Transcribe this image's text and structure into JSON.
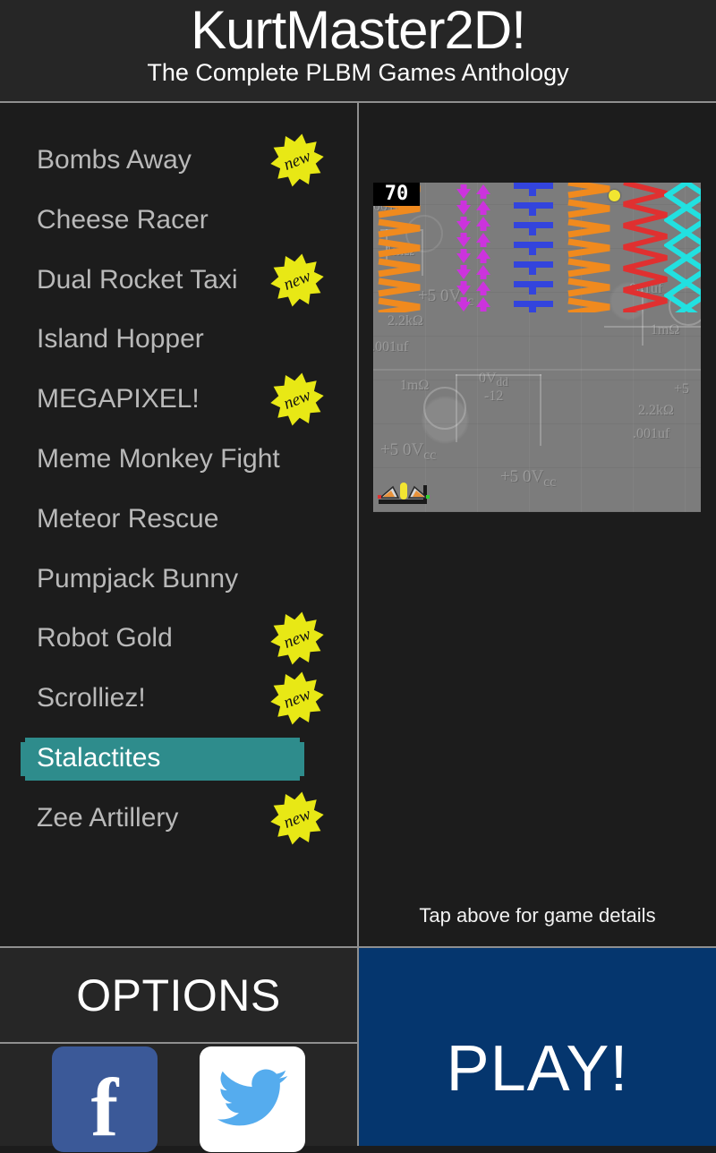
{
  "header": {
    "title": "KurtMaster2D!",
    "subtitle": "The Complete PLBM Games Anthology"
  },
  "colors": {
    "background": "#1c1c1c",
    "header_bg": "#262626",
    "divider": "#8f8f8f",
    "list_text": "#b9b9b9",
    "selected_bg": "#2e8c8c",
    "selected_text": "#ffffff",
    "badge_yellow": "#e8e815",
    "play_blue": "#05366e",
    "facebook_blue": "#3b5998",
    "twitter_blue": "#55acee"
  },
  "game_list": {
    "items": [
      {
        "label": "Bombs Away",
        "badge": "new",
        "selected": false
      },
      {
        "label": "Cheese Racer",
        "badge": "",
        "selected": false
      },
      {
        "label": "Dual Rocket Taxi",
        "badge": "new",
        "selected": false
      },
      {
        "label": "Island Hopper",
        "badge": "",
        "selected": false
      },
      {
        "label": "MEGAPIXEL!",
        "badge": "new",
        "selected": false
      },
      {
        "label": "Meme Monkey Fight",
        "badge": "",
        "selected": false
      },
      {
        "label": "Meteor Rescue",
        "badge": "",
        "selected": false
      },
      {
        "label": "Pumpjack Bunny",
        "badge": "",
        "selected": false
      },
      {
        "label": "Robot Gold",
        "badge": "new",
        "selected": false
      },
      {
        "label": "Scrolliez!",
        "badge": "new",
        "selected": false
      },
      {
        "label": "Stalactites",
        "badge": "",
        "selected": true
      },
      {
        "label": "Zee Artillery",
        "badge": "new",
        "selected": false
      }
    ]
  },
  "preview": {
    "hint": "Tap above for game details",
    "screenshot": {
      "score": "70",
      "background_labels": [
        ".001uf",
        "1mΩ",
        "+5 0Vcc",
        "2.2kΩ",
        ".001uf",
        "1mΩ",
        "0Vdd",
        "-12",
        "+5 0Vcc",
        "2.2kΩ",
        ".001uf",
        "1mΩ",
        "+5 0Vcc",
        "+5",
        "2.2kΩ",
        ".001uf",
        "+5 0Vcc"
      ],
      "hazard_columns": [
        {
          "color": "#f08a1e",
          "shape": "zigzag"
        },
        {
          "color": "#cc33dd",
          "shape": "arrows"
        },
        {
          "color": "#3344dd",
          "shape": "blocks"
        },
        {
          "color": "#f08a1e",
          "shape": "zigzag"
        },
        {
          "color": "#e03030",
          "shape": "sawtooth"
        },
        {
          "color": "#22e0e0",
          "shape": "diamonds"
        },
        {
          "color": "#f0ea20",
          "shape": "rings"
        }
      ],
      "ball_color": "#f2e531"
    }
  },
  "bottom": {
    "options_label": "OPTIONS",
    "play_label": "PLAY!",
    "social": [
      {
        "name": "facebook",
        "glyph": "f"
      },
      {
        "name": "twitter",
        "glyph": "bird"
      }
    ]
  }
}
